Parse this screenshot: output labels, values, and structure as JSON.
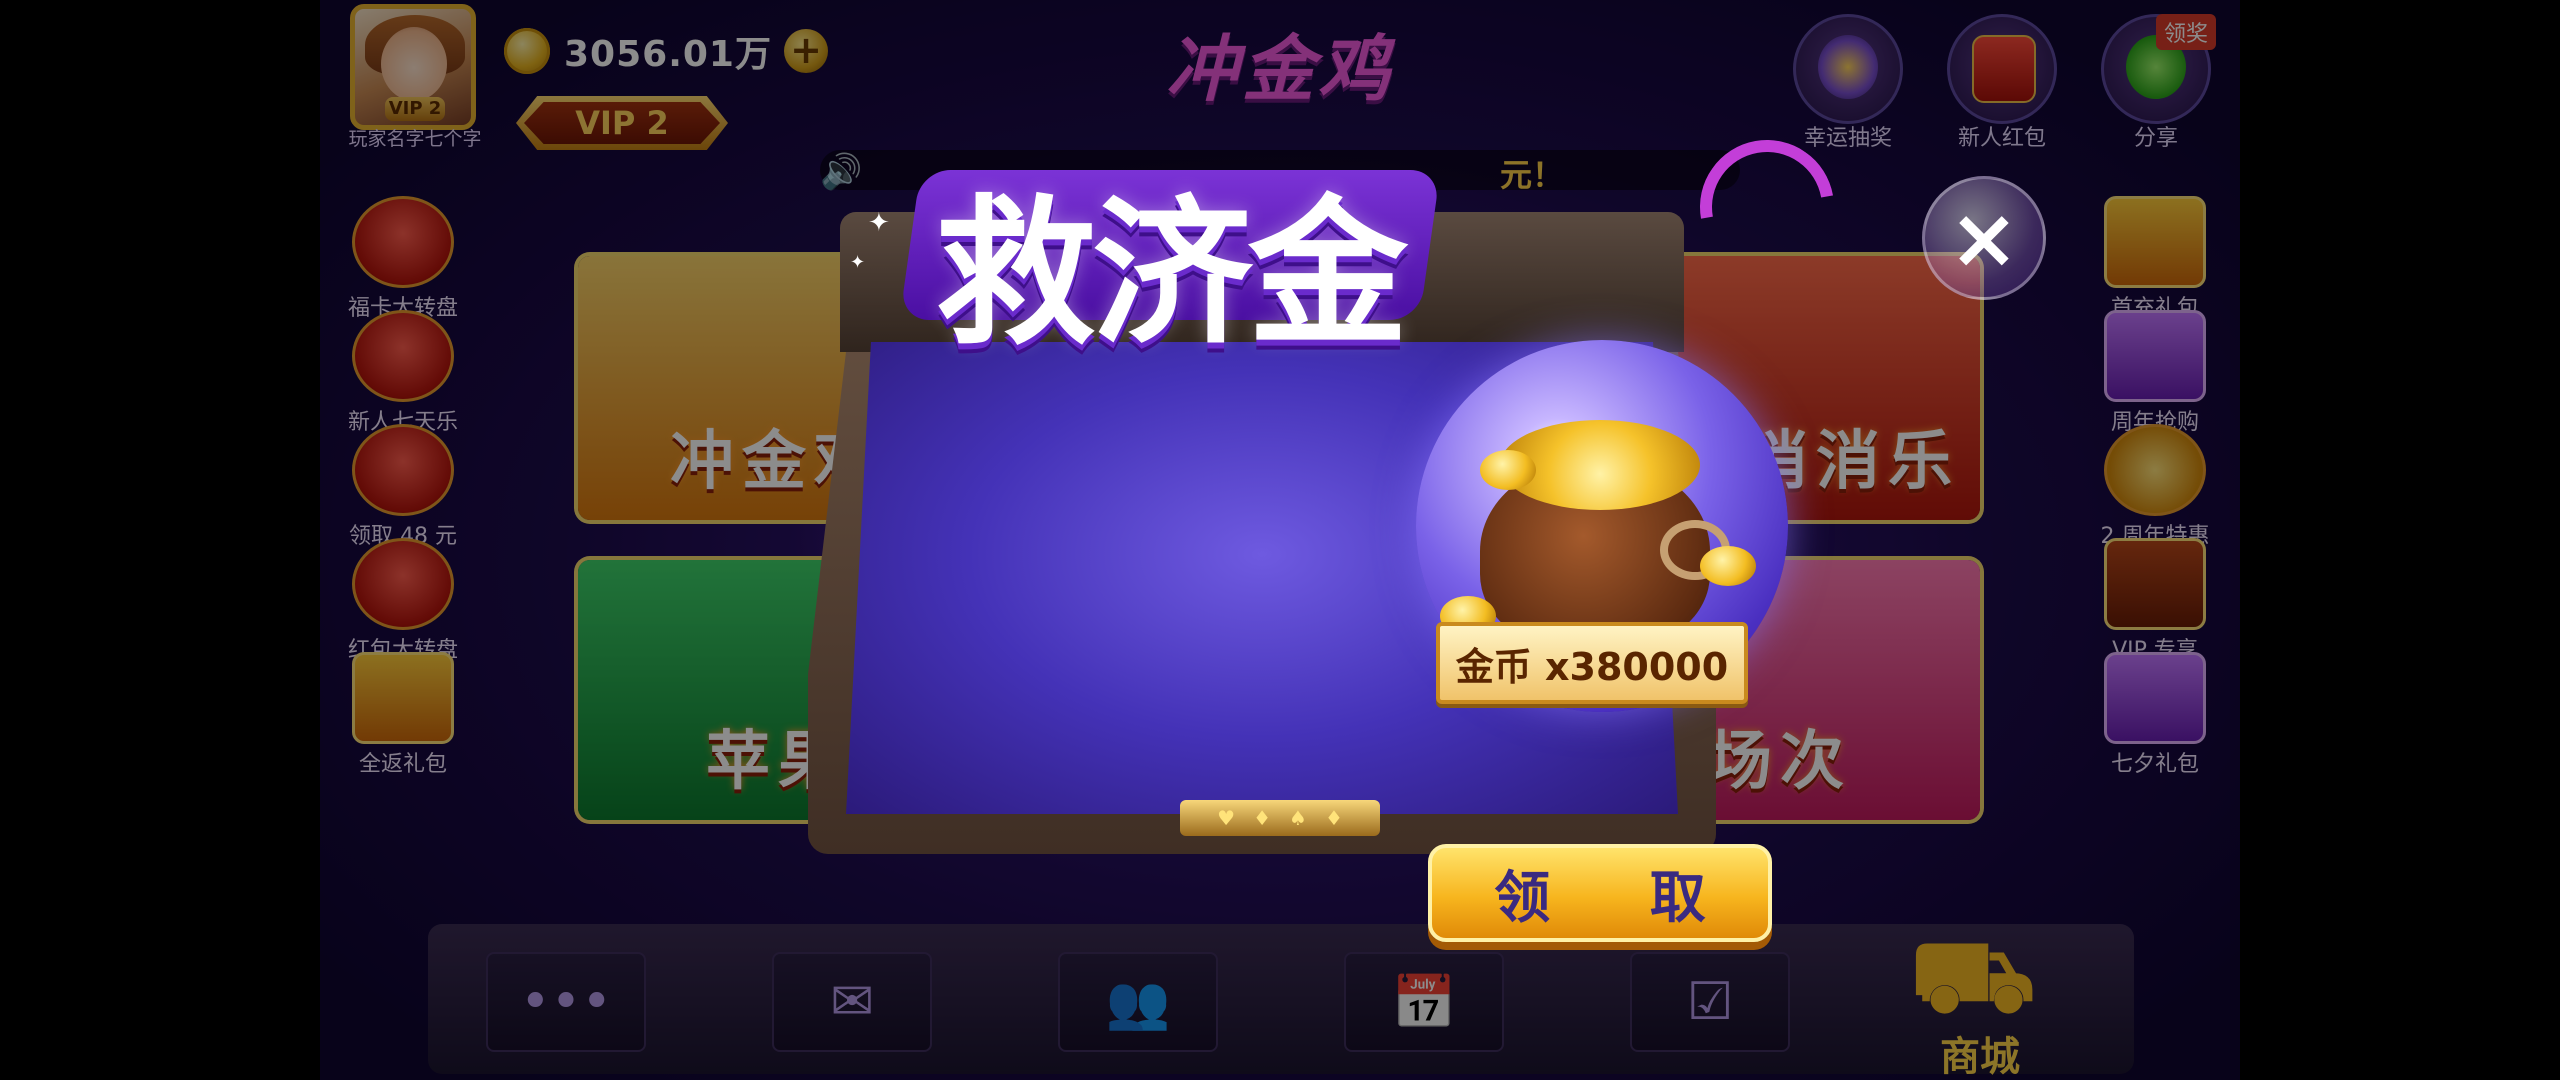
{
  "player": {
    "name": "玩家名字七个字",
    "avatar_vip": "VIP 2",
    "coins": "3056.01万",
    "vip_level": "VIP 2"
  },
  "header": {
    "game_logo": "冲金鸡",
    "marquee_tail": "元！",
    "top_icons": [
      {
        "label": "幸运抽奖",
        "icon": "lucky-wheel-icon"
      },
      {
        "label": "新人红包",
        "icon": "red-envelope-icon"
      },
      {
        "label": "分享",
        "icon": "wechat-share-icon",
        "tag": "领奖"
      }
    ]
  },
  "left_sidebar": [
    {
      "label": "福卡大转盘",
      "icon": "red-envelope-wheel-icon"
    },
    {
      "label": "新人七天乐",
      "icon": "newbie-seven-days-icon"
    },
    {
      "label": "领取 48 元",
      "icon": "claim-48-icon"
    },
    {
      "label": "红包大转盘",
      "icon": "red-envelope-wheel-icon"
    },
    {
      "label": "全返礼包",
      "icon": "full-return-gift-icon"
    }
  ],
  "right_sidebar": [
    {
      "label": "首充礼包",
      "icon": "first-recharge-gift-icon"
    },
    {
      "label": "周年抢购",
      "icon": "anniversary-sale-icon"
    },
    {
      "label": "2 周年特惠",
      "icon": "anniversary-coin-icon"
    },
    {
      "label": "VIP 专享",
      "icon": "vip-chest-icon"
    },
    {
      "label": "七夕礼包",
      "icon": "qixi-bag-icon"
    }
  ],
  "game_cards": [
    {
      "title": "冲金鸡"
    },
    {
      "title": "水果消消乐"
    },
    {
      "title": "苹果"
    },
    {
      "title": "场次"
    }
  ],
  "bottom_nav": [
    {
      "icon": "more-icon"
    },
    {
      "icon": "mail-icon"
    },
    {
      "icon": "friends-icon"
    },
    {
      "icon": "calendar-icon"
    },
    {
      "icon": "tasks-icon"
    },
    {
      "label": "商城",
      "icon": "shop-cart-icon"
    }
  ],
  "modal": {
    "title": "救济金",
    "reward_label": "金币 x380000",
    "claim_button": "领 取"
  },
  "colors": {
    "accent_gold": "#f7b51e",
    "modal_title_purple": "#6a2bcc",
    "background_purple": "#3b1a8a"
  }
}
